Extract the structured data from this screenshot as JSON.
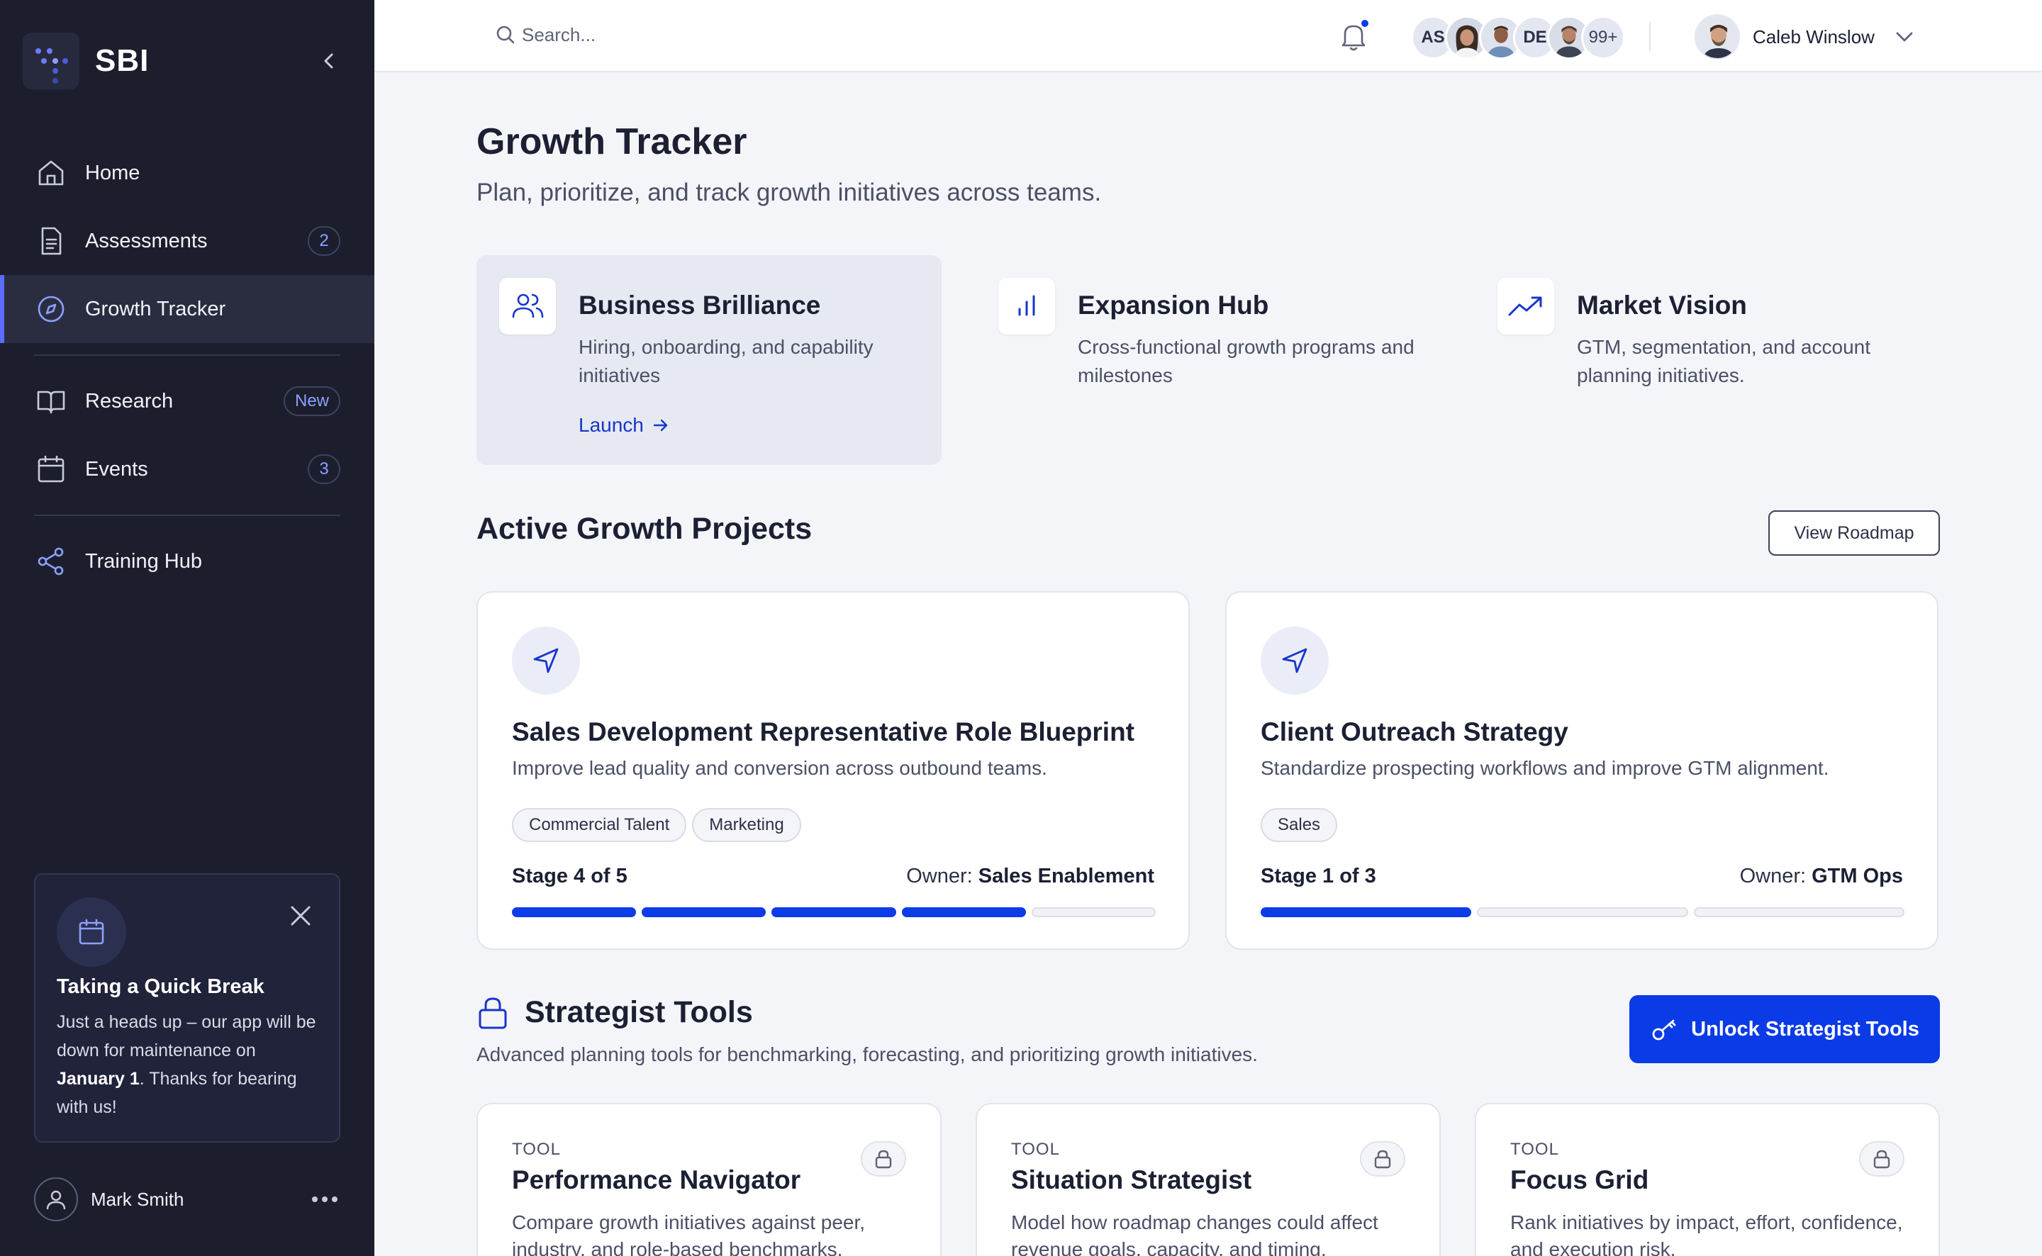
{
  "brand": {
    "name": "SBI"
  },
  "sidebar": {
    "items": [
      {
        "label": "Home",
        "icon": "home-icon"
      },
      {
        "label": "Assessments",
        "icon": "document-icon",
        "badge": "2"
      },
      {
        "label": "Growth Tracker",
        "icon": "compass-icon",
        "active": true
      },
      {
        "label": "Research",
        "icon": "book-icon",
        "badge": "New"
      },
      {
        "label": "Events",
        "icon": "calendar-icon",
        "badge": "3"
      },
      {
        "label": "Training Hub",
        "icon": "share-icon"
      }
    ],
    "notice": {
      "title": "Taking a Quick Break",
      "body_pre": "Just a heads up – our app will be down for maintenance on ",
      "body_bold": "January 1",
      "body_post": ". Thanks for bearing with us!"
    },
    "user": {
      "name": "Mark Smith"
    }
  },
  "topbar": {
    "search_placeholder": "Search...",
    "avatars": [
      "AS",
      "",
      "",
      "DE",
      ""
    ],
    "avatars_more": "99+",
    "current_user": "Caleb Winslow"
  },
  "page": {
    "title": "Growth Tracker",
    "subtitle": "Plan, prioritize, and track growth initiatives across teams."
  },
  "features": [
    {
      "title": "Business Brilliance",
      "desc": "Hiring, onboarding, and capability initiatives",
      "link": "Launch",
      "icon": "users-icon"
    },
    {
      "title": "Expansion Hub",
      "desc": "Cross-functional growth programs and milestones",
      "icon": "bar-chart-icon"
    },
    {
      "title": "Market Vision",
      "desc": "GTM, segmentation, and account planning initiatives.",
      "icon": "trending-up-icon"
    }
  ],
  "projects_section": {
    "title": "Active Growth Projects",
    "button": "View Roadmap"
  },
  "projects": [
    {
      "title": "Sales Development Representative Role Blueprint",
      "desc": "Improve lead quality and conversion across outbound teams.",
      "tags": [
        "Commercial Talent",
        "Marketing"
      ],
      "stage_label": "Stage  4 of 5",
      "owner_label": "Owner: ",
      "owner": "Sales Enablement",
      "stage": 4,
      "stages": 5
    },
    {
      "title": "Client Outreach Strategy",
      "desc": "Standardize prospecting workflows and improve GTM alignment.",
      "tags": [
        "Sales"
      ],
      "stage_label": "Stage  1 of 3",
      "owner_label": "Owner: ",
      "owner": "GTM Ops",
      "stage": 1,
      "stages": 3
    }
  ],
  "tools_section": {
    "title": "Strategist Tools",
    "subtitle": "Advanced planning tools for benchmarking, forecasting, and prioritizing growth initiatives.",
    "button": "Unlock Strategist Tools"
  },
  "tools": [
    {
      "kicker": "TOOL",
      "title": "Performance Navigator",
      "desc": "Compare growth initiatives against peer, industry, and role-based benchmarks."
    },
    {
      "kicker": "TOOL",
      "title": "Situation Strategist",
      "desc": "Model how roadmap changes could affect revenue goals, capacity, and timing."
    },
    {
      "kicker": "TOOL",
      "title": "Focus Grid",
      "desc": "Rank initiatives by impact, effort, confidence, and execution risk."
    }
  ],
  "colors": {
    "accent": "#0a3be6",
    "sidebar_bg": "#1c1e2e",
    "page_bg": "#f4f5f9"
  }
}
